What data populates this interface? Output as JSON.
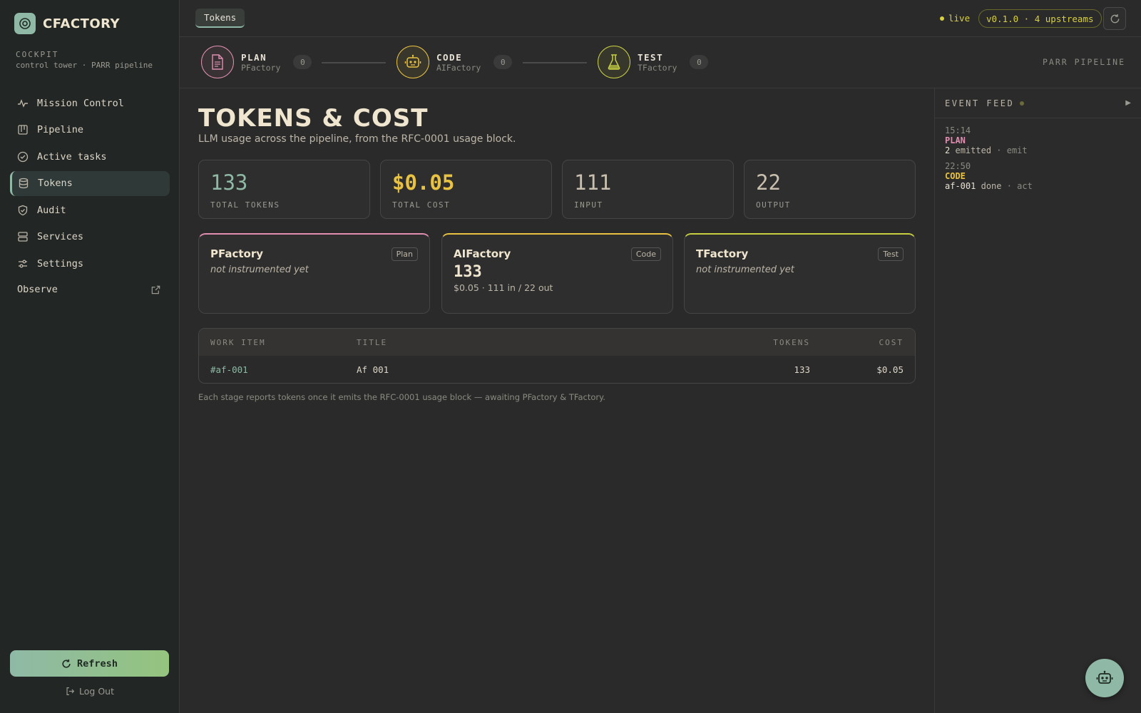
{
  "colors": {
    "accent": "#8fb9a6",
    "plan": "#e08fb0",
    "code": "#e8c240",
    "test": "#c8d040",
    "live": "#d8d040"
  },
  "sidebar": {
    "brand": "CFACTORY",
    "cockpit_title": "COCKPIT",
    "cockpit_sub": "control tower · PARR pipeline",
    "items": [
      {
        "label": "Mission Control",
        "icon": "activity-icon"
      },
      {
        "label": "Pipeline",
        "icon": "kanban-icon"
      },
      {
        "label": "Active tasks",
        "icon": "check-circle-icon"
      },
      {
        "label": "Tokens",
        "icon": "database-icon"
      },
      {
        "label": "Audit",
        "icon": "shield-check-icon"
      },
      {
        "label": "Services",
        "icon": "server-icon"
      },
      {
        "label": "Settings",
        "icon": "sliders-icon"
      }
    ],
    "observe_label": "Observe",
    "refresh_label": "Refresh",
    "logout_label": "Log Out"
  },
  "topbar": {
    "active_tab": "Tokens",
    "live_label": "live",
    "version": "v0.1.0 · 4 upstreams"
  },
  "pipeline": {
    "stages": [
      {
        "name": "PLAN",
        "sub": "PFactory",
        "count": "0"
      },
      {
        "name": "CODE",
        "sub": "AIFactory",
        "count": "0"
      },
      {
        "name": "TEST",
        "sub": "TFactory",
        "count": "0"
      }
    ],
    "label": "PARR PIPELINE"
  },
  "main": {
    "title": "TOKENS & COST",
    "subtitle": "LLM usage across the pipeline, from the RFC-0001 usage block.",
    "stats": [
      {
        "value": "133",
        "label": "TOTAL TOKENS"
      },
      {
        "value": "$0.05",
        "label": "TOTAL COST"
      },
      {
        "value": "111",
        "label": "INPUT"
      },
      {
        "value": "22",
        "label": "OUTPUT"
      }
    ],
    "factories": [
      {
        "name": "PFactory",
        "badge": "Plan",
        "note": "not instrumented yet"
      },
      {
        "name": "AIFactory",
        "badge": "Code",
        "value": "133",
        "detail": "$0.05 · 111 in / 22 out"
      },
      {
        "name": "TFactory",
        "badge": "Test",
        "note": "not instrumented yet"
      }
    ],
    "table": {
      "headers": [
        "WORK ITEM",
        "TITLE",
        "TOKENS",
        "COST"
      ],
      "rows": [
        {
          "item": "#af-001",
          "title": "Af 001",
          "tokens": "133",
          "cost": "$0.05"
        }
      ]
    },
    "footnote": "Each stage reports tokens once it emits the RFC-0001 usage block — awaiting PFactory & TFactory."
  },
  "feed": {
    "title": "EVENT FEED",
    "toggle": "▶",
    "events": [
      {
        "time": "15:14",
        "stage": "PLAN",
        "id": "2",
        "text": "emitted",
        "kind": "· emit"
      },
      {
        "time": "22:50",
        "stage": "CODE",
        "id": "af-001",
        "text": "done",
        "kind": "· act"
      }
    ]
  }
}
